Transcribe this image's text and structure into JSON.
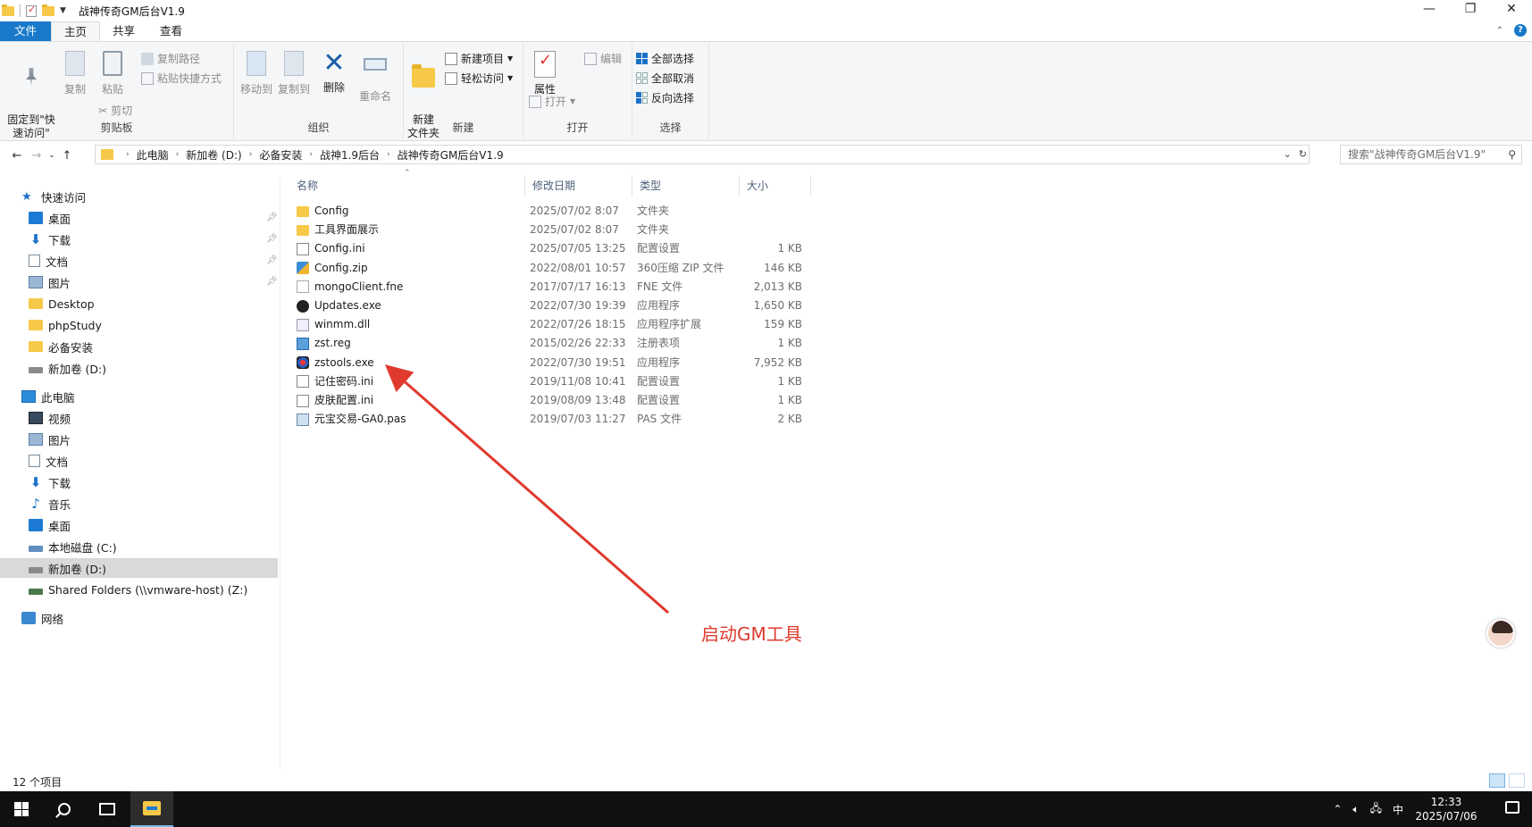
{
  "window": {
    "title": "战神传奇GM后台V1.9",
    "controls": {
      "minimize": "—",
      "maximize": "❐",
      "close": "✕"
    }
  },
  "ribbon_tabs": [
    "文件",
    "主页",
    "共享",
    "查看"
  ],
  "ribbon": {
    "clipboard": {
      "pin": "固定到\"快\n速访问\"",
      "copy": "复制",
      "paste": "粘贴",
      "copy_path": "复制路径",
      "paste_shortcut": "粘贴快捷方式",
      "cut": "剪切",
      "group": "剪贴板"
    },
    "organize": {
      "move_to": "移动到",
      "copy_to": "复制到",
      "delete": "删除",
      "rename": "重命名",
      "group": "组织"
    },
    "new": {
      "new_folder": "新建\n文件夹",
      "new_item": "新建项目",
      "easy_access": "轻松访问",
      "group": "新建"
    },
    "open": {
      "properties": "属性",
      "open": "打开",
      "edit": "编辑",
      "group": "打开"
    },
    "select": {
      "select_all": "全部选择",
      "select_none": "全部取消",
      "invert": "反向选择",
      "group": "选择"
    }
  },
  "address": {
    "crumbs": [
      "此电脑",
      "新加卷 (D:)",
      "必备安装",
      "战神1.9后台",
      "战神传奇GM后台V1.9"
    ],
    "search_placeholder": "搜索\"战神传奇GM后台V1.9\""
  },
  "nav": {
    "quick_access": "快速访问",
    "quick_items": [
      {
        "label": "桌面",
        "icon": "desktop-icon",
        "pinned": true
      },
      {
        "label": "下载",
        "icon": "download-icon",
        "pinned": true
      },
      {
        "label": "文档",
        "icon": "document-icon",
        "pinned": true
      },
      {
        "label": "图片",
        "icon": "picture-icon",
        "pinned": true
      },
      {
        "label": "Desktop",
        "icon": "folder-icon",
        "pinned": false
      },
      {
        "label": "phpStudy",
        "icon": "folder-icon",
        "pinned": false
      },
      {
        "label": "必备安装",
        "icon": "folder-icon",
        "pinned": false
      },
      {
        "label": "新加卷 (D:)",
        "icon": "drive-icon",
        "pinned": false
      }
    ],
    "this_pc": "此电脑",
    "pc_items": [
      {
        "label": "视频",
        "icon": "video-icon"
      },
      {
        "label": "图片",
        "icon": "picture-icon"
      },
      {
        "label": "文档",
        "icon": "document-icon"
      },
      {
        "label": "下载",
        "icon": "download-icon"
      },
      {
        "label": "音乐",
        "icon": "music-icon"
      },
      {
        "label": "桌面",
        "icon": "desktop-icon"
      },
      {
        "label": "本地磁盘 (C:)",
        "icon": "drive-icon"
      },
      {
        "label": "新加卷 (D:)",
        "icon": "drive-icon",
        "selected": true
      },
      {
        "label": "Shared Folders (\\\\vmware-host) (Z:)",
        "icon": "network-drive-icon"
      }
    ],
    "network": "网络"
  },
  "columns": {
    "name": "名称",
    "date": "修改日期",
    "type": "类型",
    "size": "大小"
  },
  "files": [
    {
      "name": "Config",
      "date": "2025/07/02 8:07",
      "type": "文件夹",
      "size": "",
      "icon": "folder"
    },
    {
      "name": "工具界面展示",
      "date": "2025/07/02 8:07",
      "type": "文件夹",
      "size": "",
      "icon": "folder"
    },
    {
      "name": "Config.ini",
      "date": "2025/07/05 13:25",
      "type": "配置设置",
      "size": "1 KB",
      "icon": "ini"
    },
    {
      "name": "Config.zip",
      "date": "2022/08/01 10:57",
      "type": "360压缩 ZIP 文件",
      "size": "146 KB",
      "icon": "zip"
    },
    {
      "name": "mongoClient.fne",
      "date": "2017/07/17 16:13",
      "type": "FNE 文件",
      "size": "2,013 KB",
      "icon": "fne"
    },
    {
      "name": "Updates.exe",
      "date": "2022/07/30 19:39",
      "type": "应用程序",
      "size": "1,650 KB",
      "icon": "exe1"
    },
    {
      "name": "winmm.dll",
      "date": "2022/07/26 18:15",
      "type": "应用程序扩展",
      "size": "159 KB",
      "icon": "dll"
    },
    {
      "name": "zst.reg",
      "date": "2015/02/26 22:33",
      "type": "注册表项",
      "size": "1 KB",
      "icon": "reg"
    },
    {
      "name": "zstools.exe",
      "date": "2022/07/30 19:51",
      "type": "应用程序",
      "size": "7,952 KB",
      "icon": "exe2"
    },
    {
      "name": "记住密码.ini",
      "date": "2019/11/08 10:41",
      "type": "配置设置",
      "size": "1 KB",
      "icon": "ini"
    },
    {
      "name": "皮肤配置.ini",
      "date": "2019/08/09 13:48",
      "type": "配置设置",
      "size": "1 KB",
      "icon": "ini"
    },
    {
      "name": "元宝交易-GA0.pas",
      "date": "2019/07/03 11:27",
      "type": "PAS 文件",
      "size": "2 KB",
      "icon": "pas"
    }
  ],
  "annotation": {
    "text": "启动GM工具",
    "color": "#e03a2e"
  },
  "status": {
    "count": "12 个项目"
  },
  "taskbar": {
    "tray_ime": "中",
    "time": "12:33",
    "date": "2025/07/06"
  },
  "colors": {
    "accent": "#1979ca",
    "selected_row": "#d9d9d9"
  }
}
